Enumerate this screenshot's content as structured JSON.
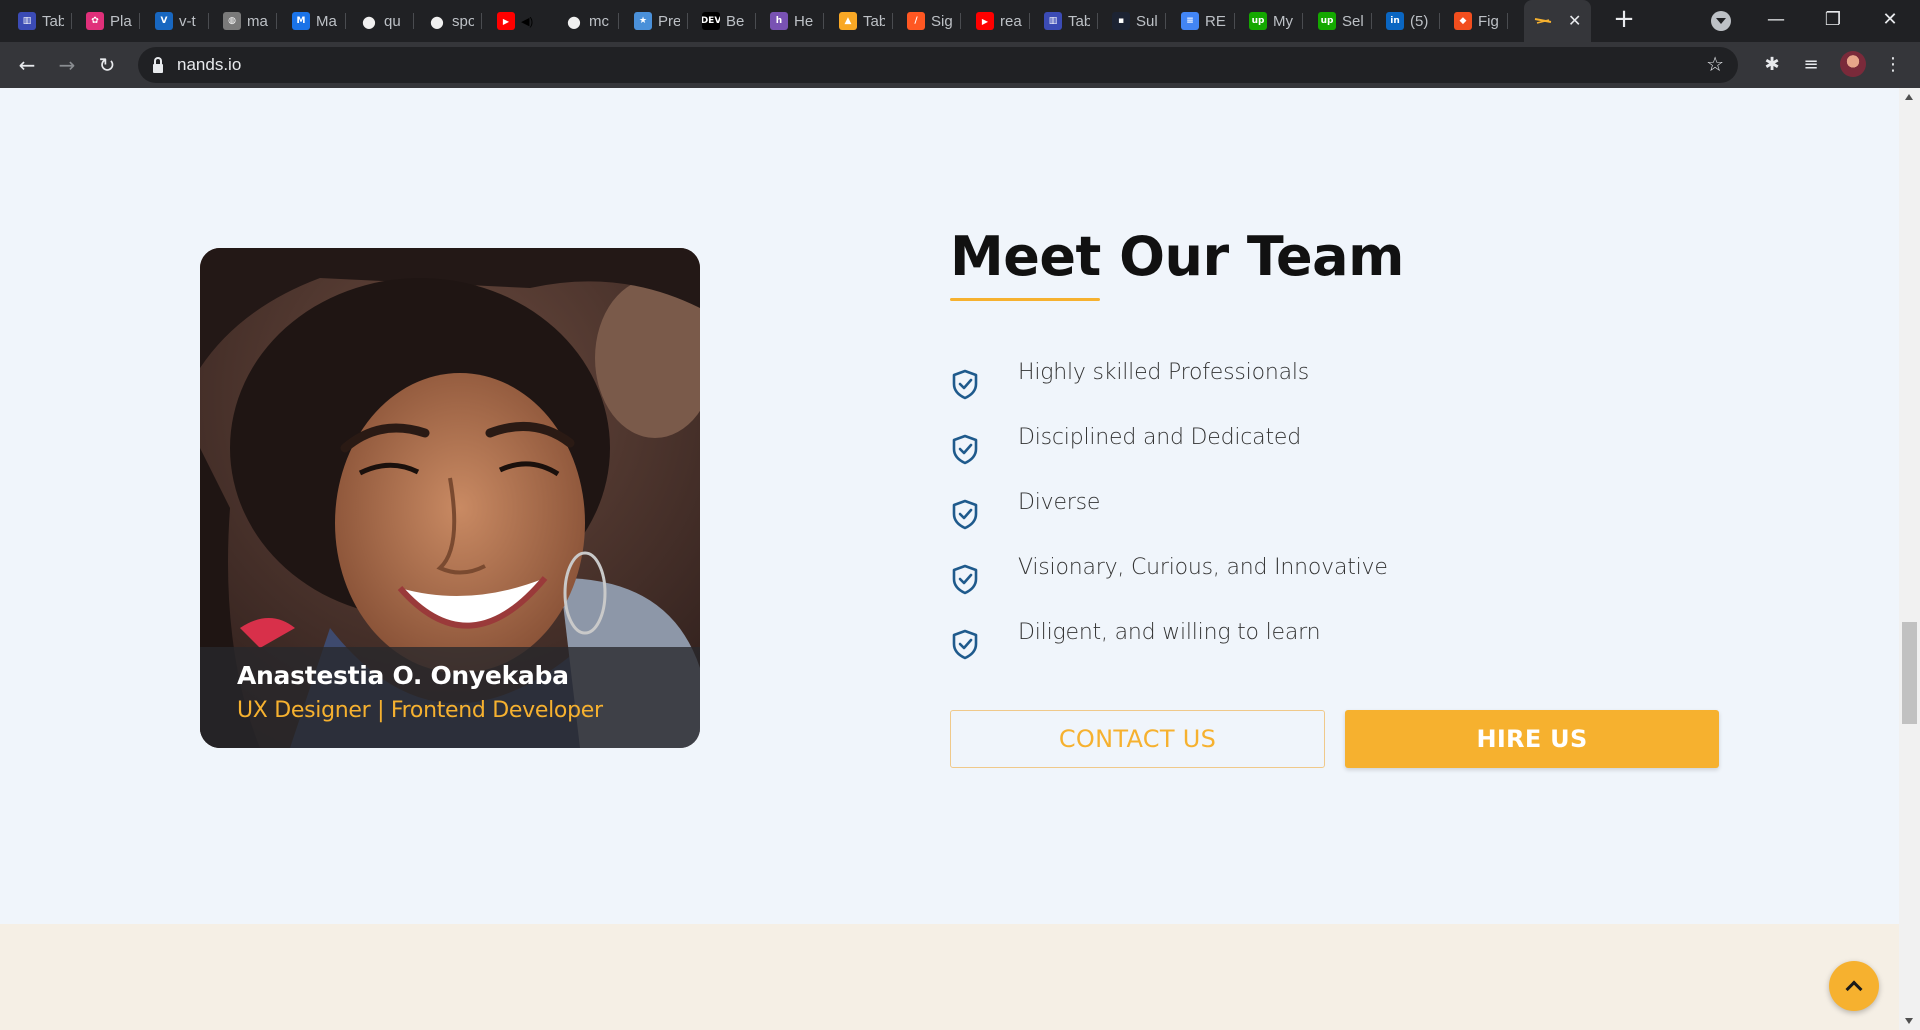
{
  "browser": {
    "tabs": [
      {
        "title": "Tab",
        "icon": "bar-chart-icon",
        "color": "#3b4bb5"
      },
      {
        "title": "Pla",
        "icon": "pink-app-icon",
        "color": "#e0307a"
      },
      {
        "title": "v-t",
        "icon": "vuetify-icon",
        "color": "#1867c0"
      },
      {
        "title": "ma",
        "icon": "globe-icon",
        "color": "#7a7a7a"
      },
      {
        "title": "Ma",
        "icon": "mui-icon",
        "color": "#1a73e8"
      },
      {
        "title": "qu",
        "icon": "github-icon",
        "color": "#f0f0f0"
      },
      {
        "title": "spo",
        "icon": "github-icon",
        "color": "#f0f0f0"
      },
      {
        "title": "",
        "icon": "youtube-icon",
        "color": "#ff0000"
      },
      {
        "title": "mc",
        "icon": "github-icon",
        "color": "#f0f0f0"
      },
      {
        "title": "Pre",
        "icon": "star-app-icon",
        "color": "#4a90d9"
      },
      {
        "title": "Be",
        "icon": "dev-icon",
        "color": "#000000"
      },
      {
        "title": "He",
        "icon": "heroku-icon",
        "color": "#7952b3"
      },
      {
        "title": "Tab",
        "icon": "firebase-icon",
        "color": "#f9a825"
      },
      {
        "title": "Sig",
        "icon": "slash-app-icon",
        "color": "#ff5722"
      },
      {
        "title": "rea",
        "icon": "youtube-icon",
        "color": "#ff0000"
      },
      {
        "title": "Tab",
        "icon": "bar-chart-icon",
        "color": "#3b4bb5"
      },
      {
        "title": "Sul",
        "icon": "dark-app-icon",
        "color": "#1c2333"
      },
      {
        "title": "RE",
        "icon": "docs-icon",
        "color": "#4285f4"
      },
      {
        "title": "My",
        "icon": "upwork-icon",
        "color": "#14a800"
      },
      {
        "title": "Sel",
        "icon": "upwork-icon",
        "color": "#14a800"
      },
      {
        "title": "(5)",
        "icon": "linkedin-icon",
        "color": "#0a66c2"
      },
      {
        "title": "Fig",
        "icon": "figma-icon",
        "color": "#f24e1e"
      }
    ],
    "active_tab": {
      "icon": "nands-logo-icon",
      "close": "✕"
    },
    "new_tab": "+",
    "url": "nands.io",
    "window_controls": {
      "minimize": "—",
      "restore": "❐",
      "close": "✕"
    }
  },
  "profile": {
    "name": "Anastestia O. Onyekaba",
    "role": "UX Designer | Frontend Developer"
  },
  "section": {
    "heading": "Meet Our Team",
    "features": [
      "Highly skilled Professionals",
      "Disciplined and Dedicated",
      "Diverse",
      "Visionary, Curious, and Innovative",
      "Diligent, and willing to learn"
    ],
    "contact_label": "CONTACT US",
    "hire_label": "HIRE US"
  },
  "colors": {
    "accent": "#f6b12f",
    "check_icon": "#1f5a8c",
    "page_bg": "#f0f5fb",
    "lower_band_bg": "#f5efe5"
  }
}
